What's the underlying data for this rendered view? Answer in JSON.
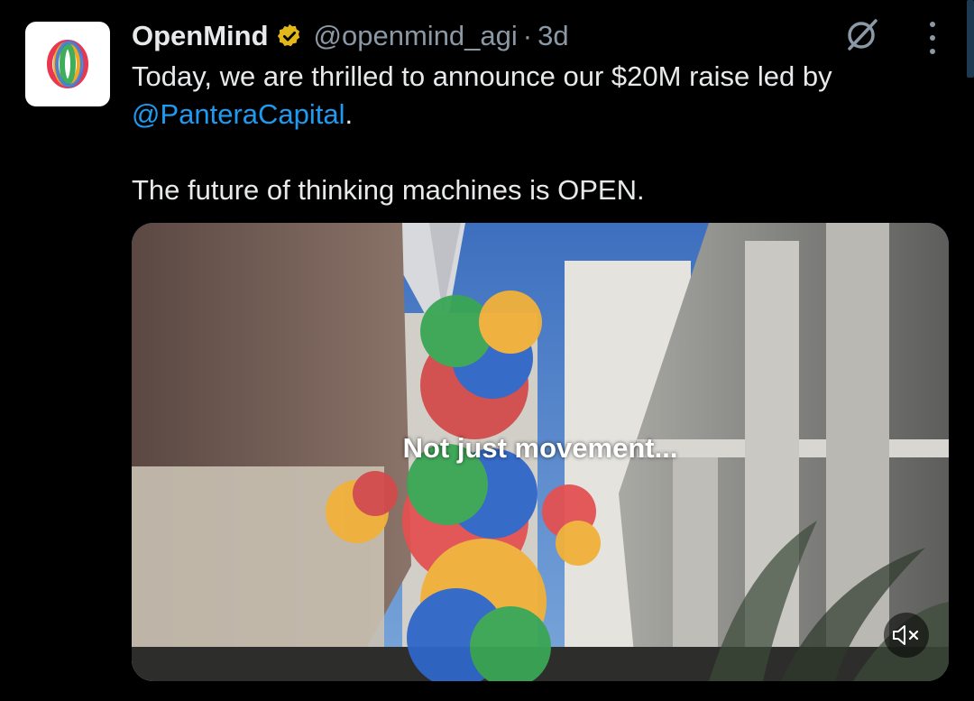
{
  "tweet": {
    "author_name": "OpenMind",
    "author_handle": "@openmind_agi",
    "separator": "·",
    "timestamp": "3d",
    "text_line1_prefix": "Today, we are thrilled to announce our $20M raise led by",
    "mention": "@PanteraCapital",
    "text_line1_suffix": ".",
    "text_line2": "The future of thinking machines is OPEN."
  },
  "media": {
    "type": "video",
    "caption": "Not just movement...",
    "mute_icon": "speaker-muted-icon"
  },
  "colors": {
    "background": "#000000",
    "text": "#e7e9ea",
    "secondary": "#8b98a5",
    "link": "#1d9bf0",
    "verified_badge": "#e2b719"
  },
  "icons": {
    "verified": "verified-badge-icon",
    "grok": "grok-icon",
    "more": "more-options-icon",
    "avatar": "openmind-logo"
  }
}
